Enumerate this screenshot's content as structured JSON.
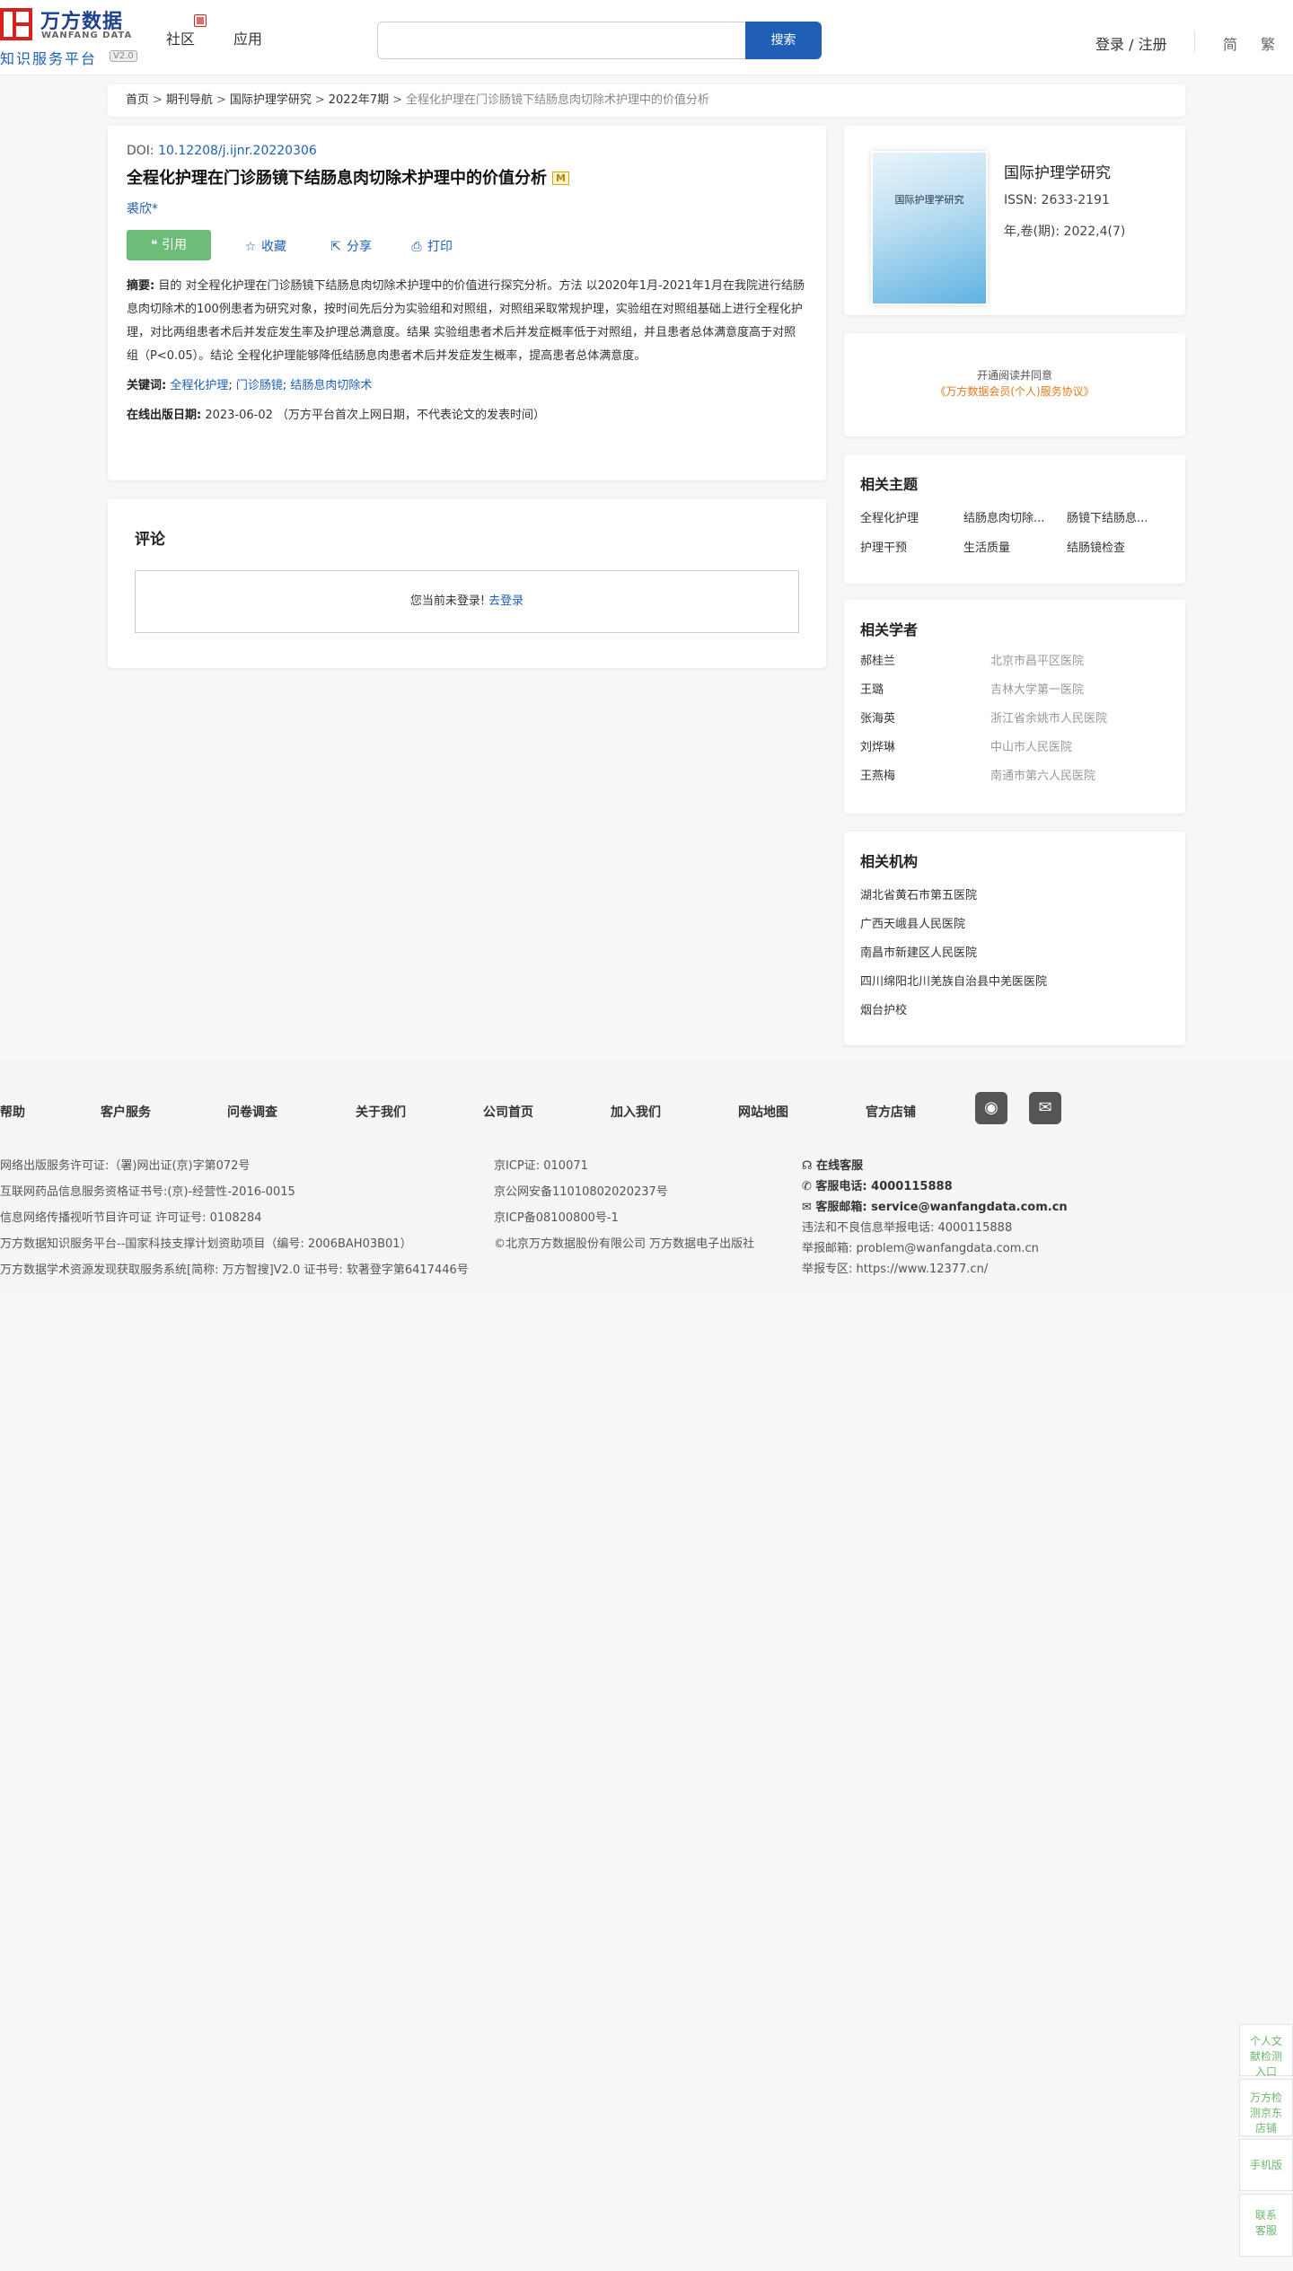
{
  "header": {
    "logo_cn": "万方数据",
    "logo_en": "WANFANG DATA",
    "logo_sub": "知识服务平台",
    "logo_version": "V2.0",
    "nav": [
      "社区",
      "应用"
    ],
    "search_placeholder": "",
    "search_button": "搜索",
    "login": "登录 / 注册",
    "lang_simplified": "简",
    "lang_traditional": "繁"
  },
  "breadcrumb": {
    "items": [
      "首页",
      "期刊导航",
      "国际护理学研究",
      "2022年7期"
    ],
    "current": "全程化护理在门诊肠镜下结肠息肉切除术护理中的价值分析",
    "separator": ">"
  },
  "article": {
    "doi_label": "DOI:",
    "doi": "10.12208/j.ijnr.20220306",
    "title": "全程化护理在门诊肠镜下结肠息肉切除术护理中的价值分析",
    "badge": "M",
    "author": "裘欣*",
    "actions": {
      "cite": "引用",
      "favorite": "收藏",
      "share": "分享",
      "print": "打印"
    },
    "abstract_label": "摘要:",
    "abstract": "目的 对全程化护理在门诊肠镜下结肠息肉切除术护理中的价值进行探究分析。方法 以2020年1月-2021年1月在我院进行结肠息肉切除术的100例患者为研究对象，按时间先后分为实验组和对照组，对照组采取常规护理，实验组在对照组基础上进行全程化护理，对比两组患者术后并发症发生率及护理总满意度。结果 实验组患者术后并发症概率低于对照组，并且患者总体满意度高于对照组（P<0.05）。结论 全程化护理能够降低结肠息肉患者术后并发症发生概率，提高患者总体满意度。",
    "keywords_label": "关键词:",
    "keywords": [
      "全程化护理",
      "门诊肠镜",
      "结肠息肉切除术"
    ],
    "date_label": "在线出版日期:",
    "date": "2023-06-02",
    "date_note": "（万方平台首次上网日期，不代表论文的发表时间）"
  },
  "comment": {
    "title": "评论",
    "prompt": "您当前未登录!",
    "login_link": "去登录"
  },
  "journal": {
    "cover_title": "国际护理学研究",
    "name": "国际护理学研究",
    "issn": "ISSN: 2633-2191",
    "volume": "年,卷(期): 2022,4(7)"
  },
  "agreement": {
    "line1": "开通阅读并同意",
    "line2": "《万方数据会员(个人)服务协议》"
  },
  "related_topics": {
    "title": "相关主题",
    "items": [
      "全程化护理",
      "结肠息肉切除...",
      "肠镜下结肠息...",
      "护理干预",
      "生活质量",
      "结肠镜检查"
    ]
  },
  "related_scholars": {
    "title": "相关学者",
    "items": [
      {
        "name": "郝桂兰",
        "org": "北京市昌平区医院"
      },
      {
        "name": "王璐",
        "org": "吉林大学第一医院"
      },
      {
        "name": "张海英",
        "org": "浙江省余姚市人民医院"
      },
      {
        "name": "刘烨琳",
        "org": "中山市人民医院"
      },
      {
        "name": "王燕梅",
        "org": "南通市第六人民医院"
      }
    ]
  },
  "related_institutions": {
    "title": "相关机构",
    "items": [
      "湖北省黄石市第五医院",
      "广西天峨县人民医院",
      "南昌市新建区人民医院",
      "四川绵阳北川羌族自治县中羌医医院",
      "烟台护校"
    ]
  },
  "footer": {
    "links": [
      "帮助",
      "客户服务",
      "问卷调查",
      "关于我们",
      "公司首页",
      "加入我们",
      "网站地图",
      "官方店铺"
    ],
    "col1": [
      "网络出版服务许可证:（署)网出证(京)字第072号",
      "互联网药品信息服务资格证书号:(京)-经营性-2016-0015",
      "信息网络传播视听节目许可证 许可证号: 0108284",
      "万方数据知识服务平台--国家科技支撑计划资助项目（编号: 2006BAH03B01）",
      "万方数据学术资源发现获取服务系统[简称: 万方智搜]V2.0 证书号: 软著登字第6417446号"
    ],
    "col2": [
      "京ICP证: 010071",
      "京公网安备11010802020237号",
      "京ICP备08100800号-1",
      "©北京万方数据股份有限公司 万方数据电子出版社"
    ],
    "col3": {
      "online": "在线客服",
      "phone_label": "客服电话:",
      "phone": "4000115888",
      "email_label": "客服邮箱:",
      "email": "service@wanfangdata.com.cn",
      "report_phone": "违法和不良信息举报电话: 4000115888",
      "report_email": "举报邮箱: problem@wanfangdata.com.cn",
      "report_zone": "举报专区: https://www.12377.cn/"
    }
  },
  "float_widgets": [
    "个人文献检测入口",
    "万方检测京东店铺",
    "手机版",
    "联系客服"
  ]
}
